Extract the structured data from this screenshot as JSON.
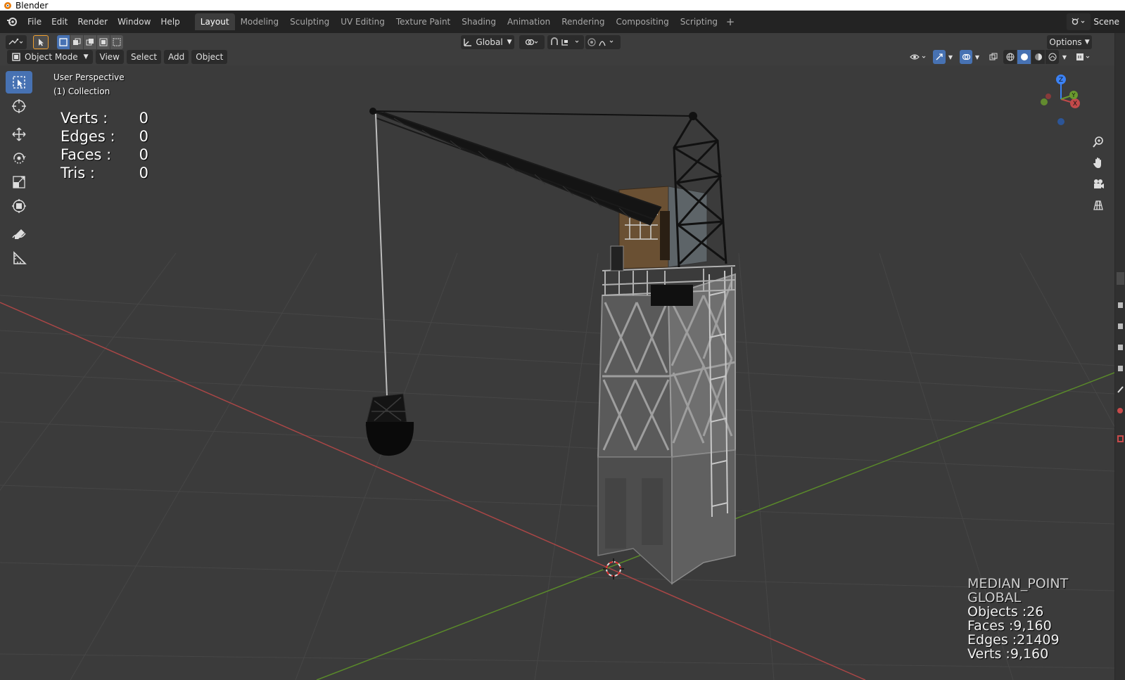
{
  "window": {
    "title": "Blender"
  },
  "menu": [
    "File",
    "Edit",
    "Render",
    "Window",
    "Help"
  ],
  "workspaces": [
    "Layout",
    "Modeling",
    "Sculpting",
    "UV Editing",
    "Texture Paint",
    "Shading",
    "Animation",
    "Rendering",
    "Compositing",
    "Scripting"
  ],
  "active_workspace": "Layout",
  "scene": {
    "label": "Scene"
  },
  "toolheader": {
    "orientation": "Global",
    "options_label": "Options"
  },
  "viewport_header": {
    "mode": "Object Mode",
    "menus": [
      "View",
      "Select",
      "Add",
      "Object"
    ]
  },
  "viewport": {
    "perspective": "User Perspective",
    "collection": "(1) Collection",
    "stats": [
      {
        "label": "Verts :",
        "value": "0"
      },
      {
        "label": "Edges :",
        "value": "0"
      },
      {
        "label": "Faces :",
        "value": "0"
      },
      {
        "label": "Tris :",
        "value": "0"
      }
    ],
    "info": {
      "pivot": "MEDIAN_POINT",
      "orientation": "GLOBAL",
      "objects": "Objects :26",
      "faces": "Faces :9,160",
      "edges": "Edges :21409",
      "verts": "Verts :9,160"
    }
  },
  "gizmo_axes": {
    "z": "Z",
    "y": "Y",
    "x": "X"
  },
  "icons": {
    "blender_logo": "blender-logo-icon",
    "editor_type": "editor-type-icon",
    "select_box": "select-box-icon",
    "cursor": "cursor-icon",
    "move": "move-icon",
    "rotate": "rotate-icon",
    "scale": "scale-icon",
    "transform": "transform-icon",
    "annotate": "annotate-icon",
    "measure": "measure-icon",
    "zoom": "zoom-icon",
    "pan": "hand-icon",
    "camera": "camera-icon",
    "grid": "grid-icon"
  },
  "colors": {
    "accent": "#4772b3",
    "x_axis": "#c24a4a",
    "y_axis": "#6a9a2e",
    "z_axis": "#3b82f6",
    "background": "#3d3d3d"
  }
}
